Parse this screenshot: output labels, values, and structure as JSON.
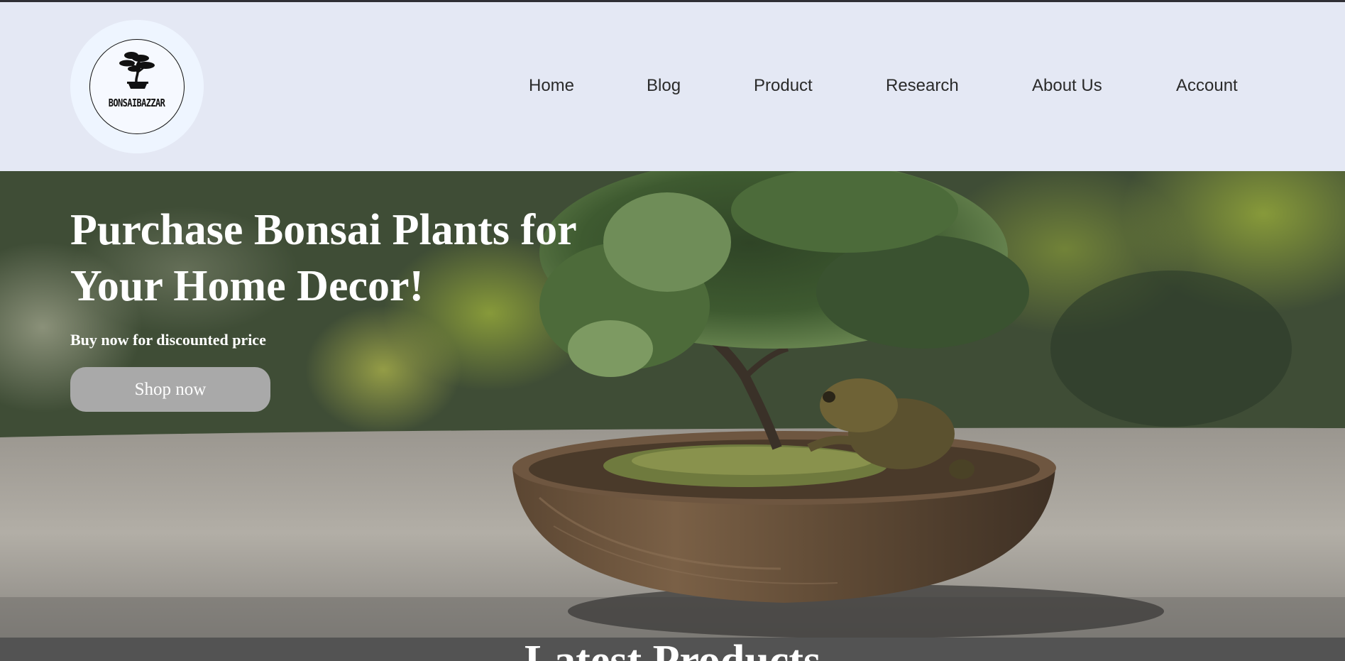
{
  "brand": {
    "name": "BONSAIBAZZAR",
    "logo_icon": "bonsai-tree-icon"
  },
  "nav": {
    "items": [
      {
        "label": "Home"
      },
      {
        "label": "Blog"
      },
      {
        "label": "Product"
      },
      {
        "label": "Research"
      },
      {
        "label": "About Us"
      },
      {
        "label": "Account"
      }
    ]
  },
  "hero": {
    "title": "Purchase Bonsai Plants for Your Home Decor!",
    "subtitle": "Buy now for discounted price",
    "cta_label": "Shop now",
    "image_subject": "bonsai tree in wooden bowl with frog"
  },
  "latest": {
    "title": "Latest Products"
  },
  "colors": {
    "header_bg": "#e4e8f4",
    "logo_bg": "#eef5ff",
    "button_bg": "#a9a9a9",
    "section_bg": "#535353",
    "text_light": "#ffffff",
    "nav_text": "#2a2a2a"
  }
}
